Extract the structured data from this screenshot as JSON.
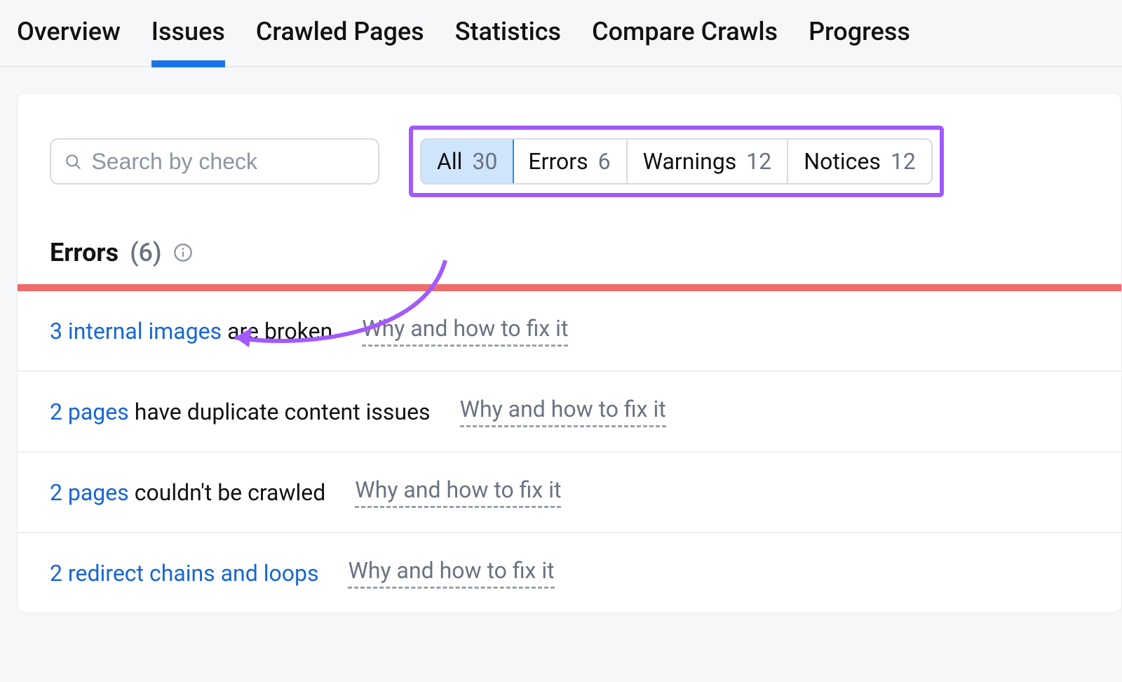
{
  "nav": {
    "tabs": [
      {
        "label": "Overview"
      },
      {
        "label": "Issues"
      },
      {
        "label": "Crawled Pages"
      },
      {
        "label": "Statistics"
      },
      {
        "label": "Compare Crawls"
      },
      {
        "label": "Progress"
      }
    ],
    "active_index": 1
  },
  "search": {
    "placeholder": "Search by check"
  },
  "filters": {
    "items": [
      {
        "label": "All",
        "count": "30"
      },
      {
        "label": "Errors",
        "count": "6"
      },
      {
        "label": "Warnings",
        "count": "12"
      },
      {
        "label": "Notices",
        "count": "12"
      }
    ],
    "active_index": 0
  },
  "section": {
    "title": "Errors",
    "count_paren": "(6)"
  },
  "fix_text": "Why and how to fix it",
  "issues": [
    {
      "link": "3 internal images",
      "rest": " are broken"
    },
    {
      "link": "2 pages",
      "rest": " have duplicate content issues"
    },
    {
      "link": "2 pages",
      "rest": " couldn't be crawled"
    },
    {
      "link": "2 redirect chains and loops",
      "rest": ""
    }
  ]
}
